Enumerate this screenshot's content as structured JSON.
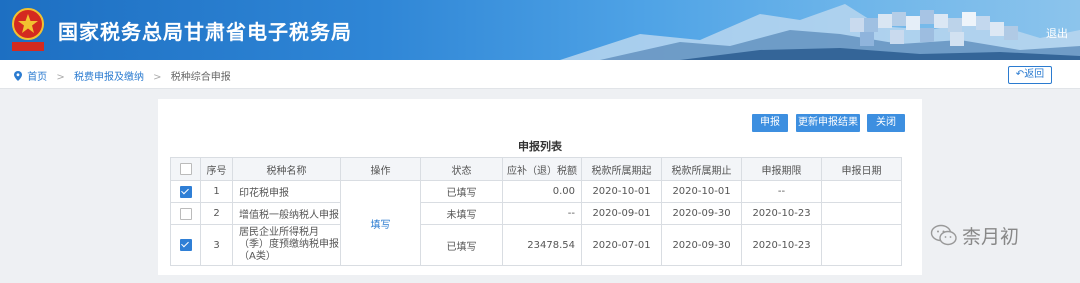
{
  "header": {
    "emblem_text": "中华人民共和国",
    "site_title": "国家税务总局甘肃省电子税务局",
    "logout_label": "退出"
  },
  "breadcrumb": {
    "items": [
      "首页",
      "税费申报及缴纳",
      "税种综合申报"
    ],
    "back_label": "返回"
  },
  "toolbar": {
    "declare_label": "申报",
    "refresh_label": "更新申报结果",
    "close_label": "关闭"
  },
  "list": {
    "title": "申报列表",
    "columns": [
      "",
      "序号",
      "税种名称",
      "操作",
      "状态",
      "应补（退）税额",
      "税款所属期起",
      "税款所属期止",
      "申报期限",
      "申报日期"
    ],
    "rows": [
      {
        "checked": true,
        "no": "1",
        "name": "印花税申报",
        "status": "已填写",
        "amount": "0.00",
        "start": "2020-10-01",
        "end": "2020-10-01",
        "deadline": "--",
        "date": ""
      },
      {
        "checked": false,
        "no": "2",
        "name": "增值税一般纳税人申报",
        "status": "未填写",
        "amount": "--",
        "start": "2020-09-01",
        "end": "2020-09-30",
        "deadline": "2020-10-23",
        "date": ""
      },
      {
        "checked": true,
        "no": "3",
        "name": "居民企业所得税月（季）度预缴纳税申报（A类）",
        "status": "已填写",
        "amount": "23478.54",
        "start": "2020-07-01",
        "end": "2020-09-30",
        "deadline": "2020-10-23",
        "date": ""
      }
    ],
    "action_label": "填写"
  },
  "watermark": {
    "text": "柰月初"
  },
  "colors": {
    "accent": "#3d8fe0",
    "link": "#2b7bd0",
    "banner": "#2f86d6"
  }
}
